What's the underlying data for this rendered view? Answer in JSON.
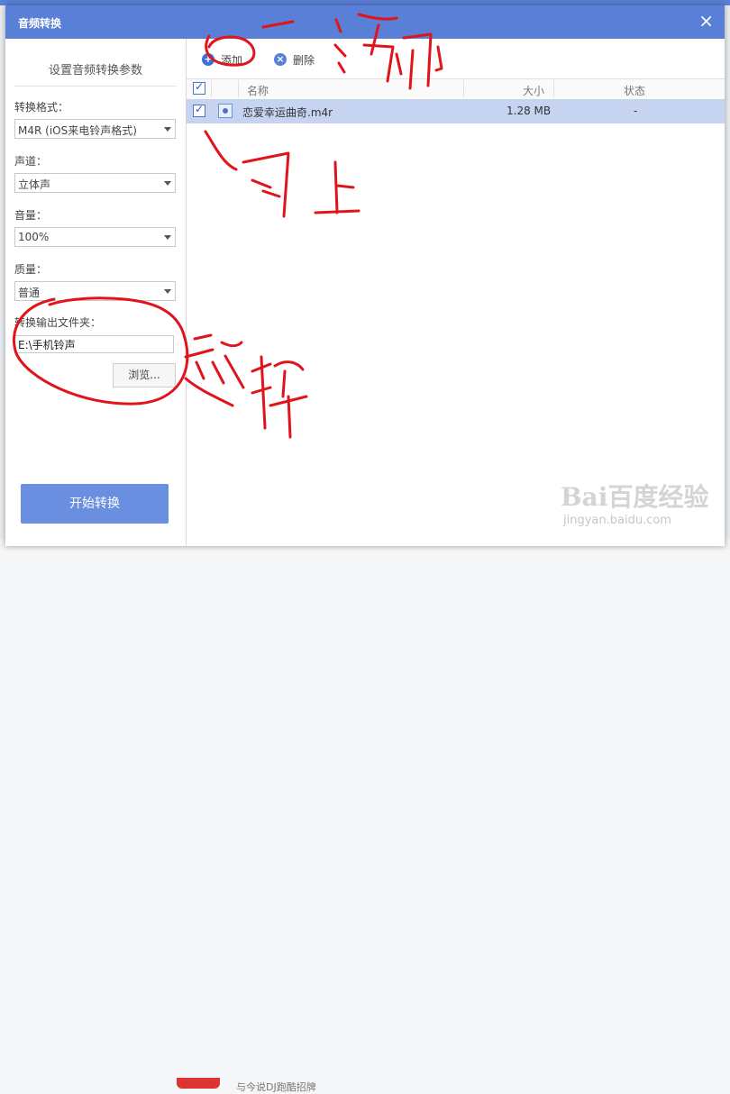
{
  "dialog": {
    "title": "音频转换",
    "close_glyph": "×"
  },
  "left_panel": {
    "heading": "设置音频转换参数",
    "format": {
      "label": "转换格式：",
      "value": "M4R (iOS来电铃声格式)"
    },
    "channel": {
      "label": "声道：",
      "value": "立体声"
    },
    "volume": {
      "label": "音量：",
      "value": "100%"
    },
    "quality": {
      "label": "质量：",
      "value": "普通"
    },
    "output_folder": {
      "label": "转换输出文件夹：",
      "value": "E:\\手机铃声"
    },
    "browse_label": "浏览...",
    "start_label": "开始转换"
  },
  "toolbar": {
    "add_label": "添加",
    "add_glyph": "+",
    "delete_label": "删除",
    "delete_glyph": "×"
  },
  "table": {
    "columns": [
      "名称",
      "大小",
      "状态"
    ],
    "rows": [
      {
        "checked": true,
        "name": "恋爱幸运曲奇.m4r",
        "size": "1.28 MB",
        "status": "-"
      }
    ]
  },
  "watermark": {
    "main": "Bai百度经验",
    "sub": "jingyan.baidu.com"
  },
  "background": {
    "bottom_text": "与今说DJ跑酷招牌"
  },
  "annotations": {
    "color": "#e0141b",
    "strokes": [
      "添加",
      "勾上",
      "选择"
    ]
  },
  "colors": {
    "accent": "#5a7fd6",
    "selection": "#c6d4f1",
    "start_button": "#6b8fe0",
    "add_icon": "#3f6fd3",
    "delete_icon": "#5a7fd6"
  }
}
